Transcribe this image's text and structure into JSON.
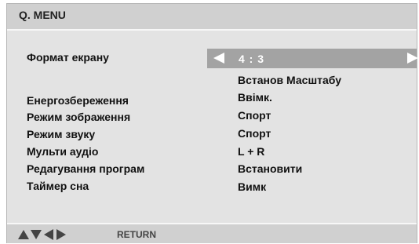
{
  "menu": {
    "title": "Q. MENU",
    "selected_item": {
      "label": "Формат екрану",
      "value": "4 : 3",
      "sub_option": "Встанов Масштабу"
    },
    "items": [
      {
        "label": "Енергозбереження",
        "value": "Ввімк."
      },
      {
        "label": "Режим зображення",
        "value": "Спорт"
      },
      {
        "label": "Режим звуку",
        "value": "Спорт"
      },
      {
        "label": "Мульти аудіо",
        "value": "L + R"
      },
      {
        "label": "Редагування програм",
        "value": "Встановити"
      },
      {
        "label": "Таймер сна",
        "value": "Вимк"
      }
    ]
  },
  "footer": {
    "nav_icons": [
      "up-arrow",
      "down-arrow",
      "left-arrow",
      "right-arrow"
    ],
    "return_label": "RETURN"
  },
  "colors": {
    "panel_bg": "#e3e3e3",
    "bar_bg": "#d0d0d0",
    "selector_bg": "#a3a3a3",
    "selector_text": "#ffffff"
  }
}
